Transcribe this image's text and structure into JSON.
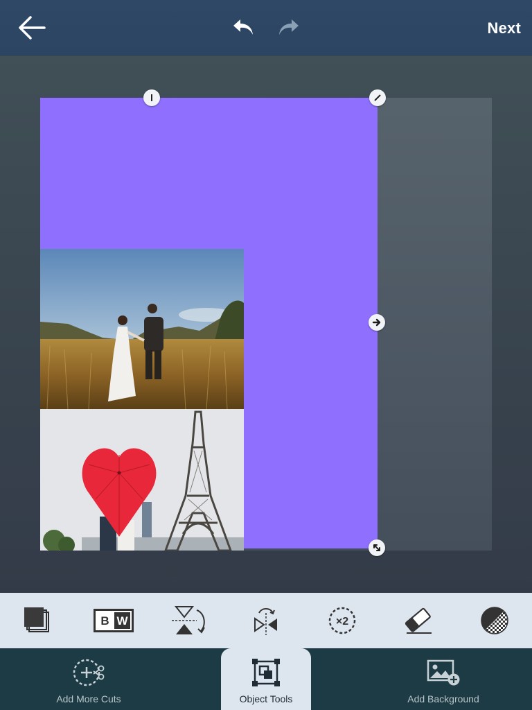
{
  "topbar": {
    "back_icon": "arrow-left-icon",
    "undo_icon": "undo-icon",
    "redo_icon": "redo-icon",
    "next_label": "Next"
  },
  "canvas": {
    "background_color": "#8e6ffe",
    "photos": [
      {
        "name": "couple-in-field-photo"
      },
      {
        "name": "heart-umbrella-eiffel-photo"
      }
    ],
    "handles": [
      "top-left-handle",
      "top-right-handle",
      "right-arrow-handle",
      "bottom-right-resize-handle"
    ]
  },
  "tools": [
    {
      "name": "layers-tool",
      "icon": "layers-icon"
    },
    {
      "name": "black-white-tool",
      "icon": "bw-icon"
    },
    {
      "name": "flip-vertical-tool",
      "icon": "flip-vertical-icon"
    },
    {
      "name": "flip-horizontal-tool",
      "icon": "flip-horizontal-icon"
    },
    {
      "name": "duplicate-tool",
      "icon": "duplicate-x2-icon"
    },
    {
      "name": "eraser-tool",
      "icon": "eraser-icon"
    },
    {
      "name": "opacity-tool",
      "icon": "opacity-icon"
    }
  ],
  "bw_label": {
    "b": "B",
    "w": "W"
  },
  "duplicate_label": "×2",
  "bottom_nav": {
    "add_more_cuts": "Add More Cuts",
    "object_tools": "Object Tools",
    "add_background": "Add Background"
  },
  "colors": {
    "topbar": "#2e4866",
    "accent_purple": "#8e6ffe",
    "tools_bg": "#dde6ee",
    "bottom_nav_bg": "#1d3b44"
  }
}
